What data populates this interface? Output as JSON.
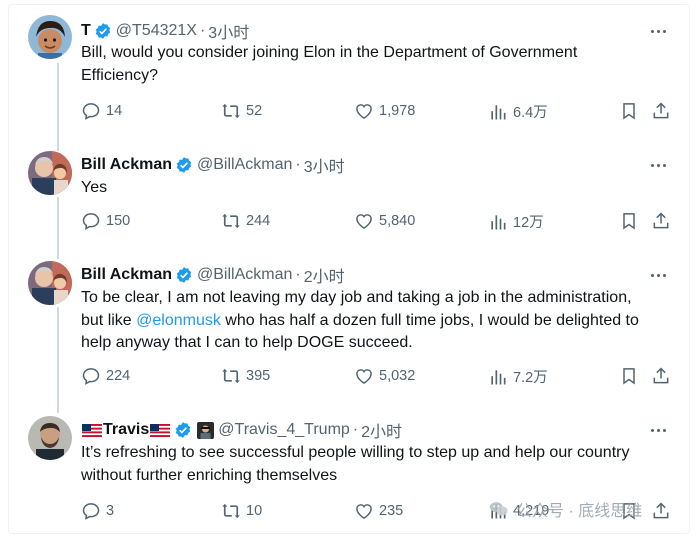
{
  "tweets": [
    {
      "name": "T",
      "handle": "@T54321X",
      "time": "3小时",
      "text": "Bill, would you consider joining Elon in the Department of Government Efficiency?",
      "replies": "14",
      "retweets": "52",
      "likes": "1,978",
      "views": "6.4万"
    },
    {
      "name": "Bill Ackman",
      "handle": "@BillAckman",
      "time": "3小时",
      "text": "Yes",
      "replies": "150",
      "retweets": "244",
      "likes": "5,840",
      "views": "12万"
    },
    {
      "name": "Bill Ackman",
      "handle": "@BillAckman",
      "time": "2小时",
      "text_before": "To be clear, I am not leaving my day job and taking a job in the administration, but like ",
      "mention": "@elonmusk",
      "text_after": " who has half a dozen full time jobs, I would be delighted to help anyway that I can to help DOGE succeed.",
      "replies": "224",
      "retweets": "395",
      "likes": "5,032",
      "views": "7.2万"
    },
    {
      "name": "Travis",
      "handle": "@Travis_4_Trump",
      "time": "2小时",
      "text": "It’s refreshing to see successful people willing to step up and help our country without further enriching themselves",
      "replies": "3",
      "retweets": "10",
      "likes": "235",
      "views": "4,219"
    }
  ],
  "separator": "·",
  "watermark": "公众号 · 底线思维",
  "colors": {
    "verified": "#1d9bf0",
    "muted": "#536471",
    "link": "#1d9bf0",
    "thread": "#cfd9de"
  },
  "icons": [
    "reply-icon",
    "retweet-icon",
    "like-icon",
    "views-icon",
    "bookmark-icon",
    "share-icon",
    "more-icon",
    "verified-icon"
  ]
}
